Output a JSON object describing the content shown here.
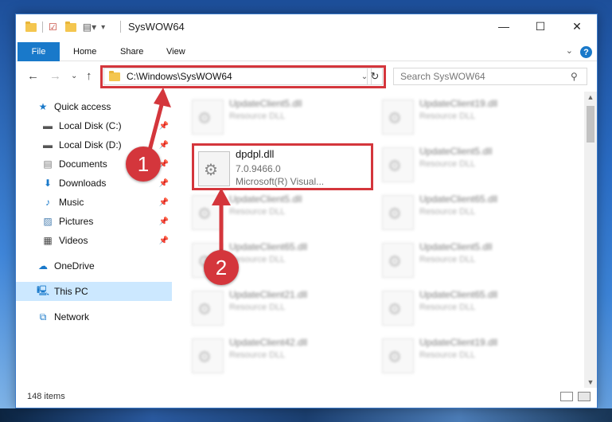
{
  "window": {
    "title": "SysWOW64",
    "minimize": "—",
    "maximize": "☐",
    "close": "✕"
  },
  "ribbon": {
    "tabs": [
      "File",
      "Home",
      "Share",
      "View"
    ]
  },
  "address": {
    "path": "C:\\Windows\\SysWOW64",
    "search_placeholder": "Search SysWOW64"
  },
  "sidebar": {
    "items": [
      {
        "label": "Quick access",
        "icon": "star-icon"
      },
      {
        "label": "Local Disk (C:)",
        "icon": "drive-icon"
      },
      {
        "label": "Local Disk (D:)",
        "icon": "drive-icon"
      },
      {
        "label": "Documents",
        "icon": "documents-icon"
      },
      {
        "label": "Downloads",
        "icon": "download-icon"
      },
      {
        "label": "Music",
        "icon": "music-icon"
      },
      {
        "label": "Pictures",
        "icon": "pictures-icon"
      },
      {
        "label": "Videos",
        "icon": "videos-icon"
      },
      {
        "label": "OneDrive",
        "icon": "cloud-icon"
      },
      {
        "label": "This PC",
        "icon": "computer-icon"
      },
      {
        "label": "Network",
        "icon": "network-icon"
      }
    ]
  },
  "files": {
    "highlighted": {
      "name": "dpdpl.dll",
      "version": "7.0.9466.0",
      "company": "Microsoft(R) Visual..."
    },
    "left_column": [
      {
        "name": "UpdateClient5.dll",
        "type": "Resource DLL"
      },
      {
        "name": "UpdateClient5.dll",
        "type": "Resource DLL"
      },
      {
        "name": "UpdateClient65.dll",
        "type": "Resource DLL"
      },
      {
        "name": "UpdateClient21.dll",
        "type": "Resource DLL"
      },
      {
        "name": "UpdateClient42.dll",
        "type": "Resource DLL"
      }
    ],
    "right_column": [
      {
        "name": "UpdateClient19.dll",
        "type": "Resource DLL"
      },
      {
        "name": "UpdateClient5.dll",
        "type": "Resource DLL"
      },
      {
        "name": "UpdateClient65.dll",
        "type": "Resource DLL"
      },
      {
        "name": "UpdateClient5.dll",
        "type": "Resource DLL"
      },
      {
        "name": "UpdateClient65.dll",
        "type": "Resource DLL"
      },
      {
        "name": "UpdateClient19.dll",
        "type": "Resource DLL"
      }
    ]
  },
  "status": {
    "count": "148 items"
  },
  "annotations": {
    "step1": "1",
    "step2": "2",
    "color": "#d4363c"
  }
}
